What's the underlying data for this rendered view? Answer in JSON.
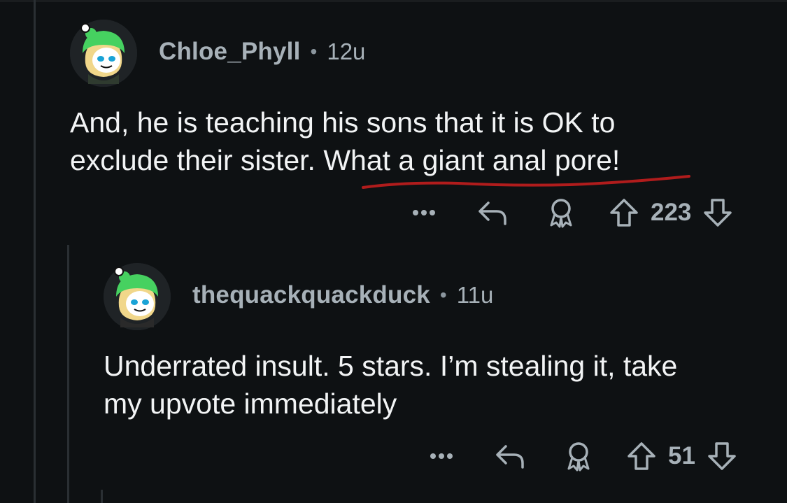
{
  "comments": [
    {
      "username": "Chloe_Phyll",
      "separator": "•",
      "age": "12u",
      "line1": "And, he is teaching his sons that it is OK to",
      "line2": "exclude their sister. What a giant anal pore!",
      "score": "223"
    },
    {
      "username": "thequackquackduck",
      "separator": "•",
      "age": "11u",
      "line1": "Underrated insult. 5 stars. I’m stealing it, take",
      "line2": "my upvote immediately",
      "score": "51"
    }
  ],
  "icons": {
    "more": "more-icon",
    "reply": "reply-icon",
    "award": "award-icon",
    "upvote": "upvote-icon",
    "downvote": "downvote-icon"
  },
  "colors": {
    "background": "#0e1113",
    "username": "#a7b1b8",
    "body_text": "#f2f4f5",
    "annotation_underline": "#b01c1c",
    "avatar_green": "#46d160"
  }
}
